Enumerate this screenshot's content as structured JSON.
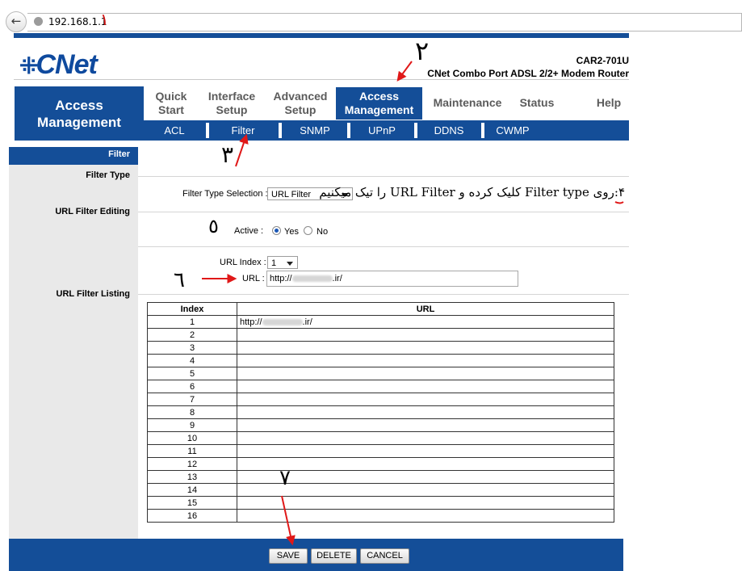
{
  "browser": {
    "url": "192.168.1.1"
  },
  "header": {
    "logo": "CNet",
    "model": "CAR2-701U",
    "product": "CNet Combo Port ADSL 2/2+ Modem Router"
  },
  "nav": {
    "page_title_line1": "Access",
    "page_title_line2": "Management",
    "items": [
      {
        "line1": "Quick",
        "line2": "Start"
      },
      {
        "line1": "Interface",
        "line2": "Setup"
      },
      {
        "line1": "Advanced",
        "line2": "Setup"
      },
      {
        "line1": "Access",
        "line2": "Management"
      },
      {
        "line1": "Maintenance",
        "line2": ""
      },
      {
        "line1": "Status",
        "line2": ""
      },
      {
        "line1": "Help",
        "line2": ""
      }
    ],
    "active_item": "Access Management",
    "subitems": [
      "ACL",
      "Filter",
      "SNMP",
      "UPnP",
      "DDNS",
      "CWMP"
    ]
  },
  "sidebar": {
    "active": "Filter",
    "sections": [
      "Filter Type",
      "URL Filter Editing",
      "URL Filter Listing"
    ]
  },
  "form": {
    "filter_type_label": "Filter Type Selection :",
    "filter_type_value": "URL Filter",
    "active_label": "Active :",
    "active_yes": "Yes",
    "active_no": "No",
    "active_selected": "Yes",
    "url_index_label": "URL Index :",
    "url_index_value": "1",
    "url_label": "URL :",
    "url_value": "http://",
    "url_value_suffix": ".ir/"
  },
  "table": {
    "headers": [
      "Index",
      "URL"
    ],
    "rows": [
      {
        "index": "1",
        "url": "http://",
        "url_suffix": ".ir/"
      },
      {
        "index": "2",
        "url": "",
        "url_suffix": ""
      },
      {
        "index": "3",
        "url": "",
        "url_suffix": ""
      },
      {
        "index": "4",
        "url": "",
        "url_suffix": ""
      },
      {
        "index": "5",
        "url": "",
        "url_suffix": ""
      },
      {
        "index": "6",
        "url": "",
        "url_suffix": ""
      },
      {
        "index": "7",
        "url": "",
        "url_suffix": ""
      },
      {
        "index": "8",
        "url": "",
        "url_suffix": ""
      },
      {
        "index": "9",
        "url": "",
        "url_suffix": ""
      },
      {
        "index": "10",
        "url": "",
        "url_suffix": ""
      },
      {
        "index": "11",
        "url": "",
        "url_suffix": ""
      },
      {
        "index": "12",
        "url": "",
        "url_suffix": ""
      },
      {
        "index": "13",
        "url": "",
        "url_suffix": ""
      },
      {
        "index": "14",
        "url": "",
        "url_suffix": ""
      },
      {
        "index": "15",
        "url": "",
        "url_suffix": ""
      },
      {
        "index": "16",
        "url": "",
        "url_suffix": ""
      }
    ]
  },
  "buttons": {
    "save": "SAVE",
    "delete": "DELETE",
    "cancel": "CANCEL"
  },
  "annotations": {
    "n1": "١",
    "n2": "٢",
    "n3": "٣",
    "n4_text": "۴:روی Filter type کلیک کرده و URL Filter را تیک میکنیم",
    "n5": "٥",
    "n6": "٦",
    "n7": "٧"
  },
  "colors": {
    "brand_blue": "#144e98",
    "sidebar_gray": "#e9e9e9",
    "annotation_red": "#e01818"
  },
  "icons": {
    "back": "back-arrow-icon",
    "site": "globe-icon",
    "dropdown": "chevron-down-icon"
  }
}
